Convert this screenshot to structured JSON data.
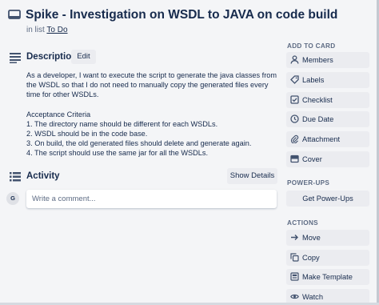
{
  "card": {
    "title": "Spike - Investigation on WSDL to JAVA on code build",
    "in_list_prefix": "in list",
    "list_name": "To Do"
  },
  "description": {
    "heading": "Description",
    "edit_label": "Edit",
    "paragraph": "As a developer, I want to execute the script to generate the java classes from the WSDL so that I do not need to manually copy the generated files every time for other WSDLs.",
    "criteria_title": "Acceptance Criteria",
    "criteria": [
      "1. The directory name should be different for each WSDLs.",
      "2. WSDL should be in the code base.",
      "3. On build, the old generated files should delete and generate again.",
      "4. The script should use the same jar for all the WSDLs."
    ]
  },
  "activity": {
    "heading": "Activity",
    "show_details_label": "Show Details",
    "avatar_initial": "G",
    "comment_placeholder": "Write a comment..."
  },
  "sidebar": {
    "add_to_card_heading": "ADD TO CARD",
    "add_to_card": [
      {
        "label": "Members",
        "icon": "person-icon"
      },
      {
        "label": "Labels",
        "icon": "label-icon"
      },
      {
        "label": "Checklist",
        "icon": "checklist-icon"
      },
      {
        "label": "Due Date",
        "icon": "clock-icon"
      },
      {
        "label": "Attachment",
        "icon": "paperclip-icon"
      },
      {
        "label": "Cover",
        "icon": "cover-icon"
      }
    ],
    "powerups_heading": "POWER-UPS",
    "get_powerups_label": "Get Power-Ups",
    "actions_heading": "ACTIONS",
    "actions": [
      {
        "label": "Move",
        "icon": "arrow-right-icon"
      },
      {
        "label": "Copy",
        "icon": "copy-icon"
      },
      {
        "label": "Make Template",
        "icon": "template-icon"
      },
      {
        "label": "Watch",
        "icon": "eye-icon"
      }
    ]
  }
}
